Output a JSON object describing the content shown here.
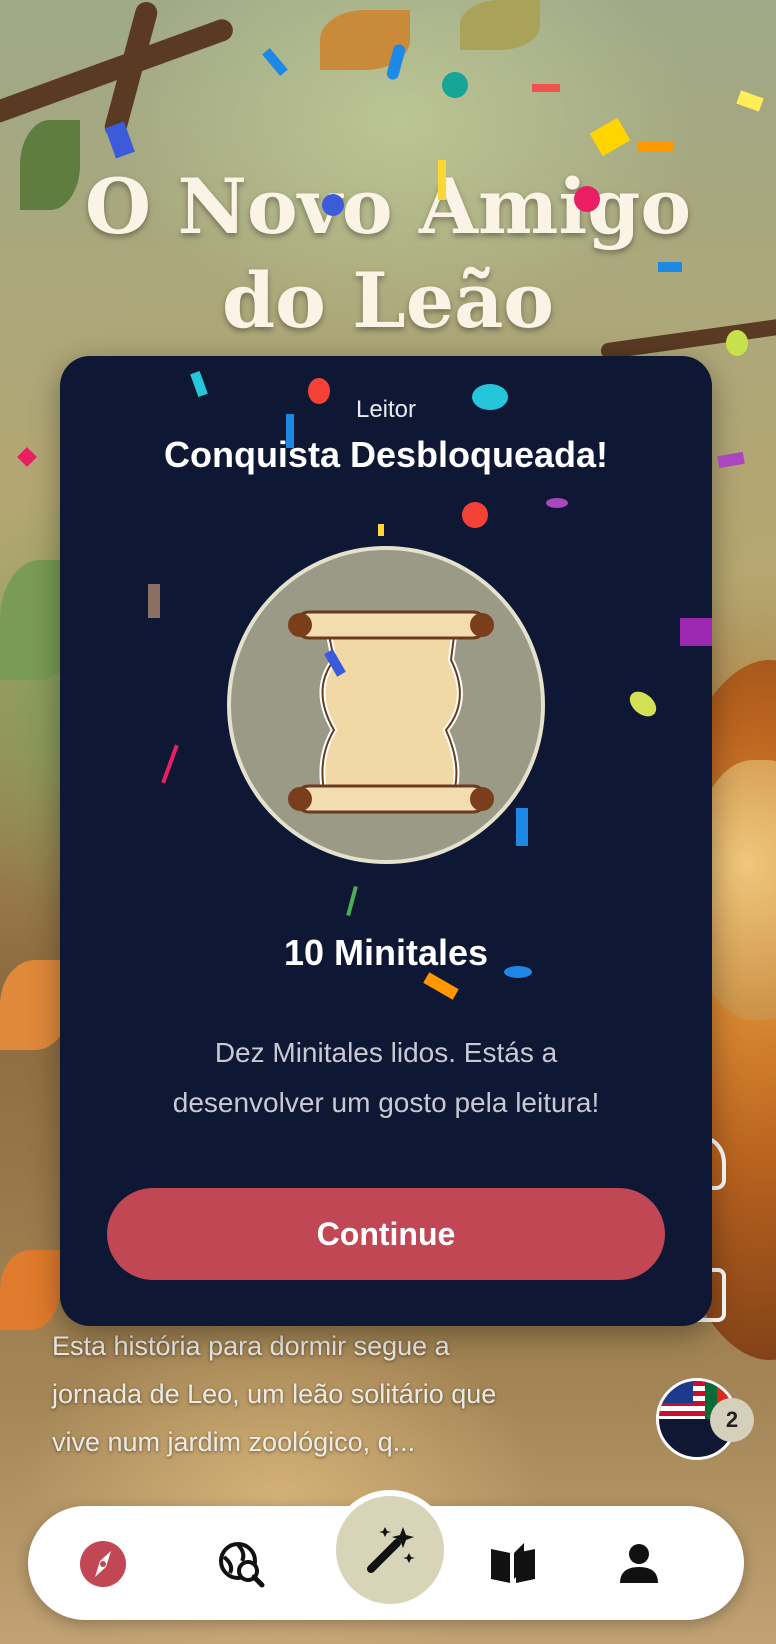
{
  "story": {
    "title_line1": "O Novo Amigo",
    "title_line2": "do Leão",
    "description_line1": "Esta história para dormir segue a",
    "description_line2": "jornada de Leo, um leão solitário que",
    "description_line3": "vive num jardim zoológico, q..."
  },
  "achievement_modal": {
    "eyebrow": "Leitor",
    "title": "Conquista Desbloqueada!",
    "badge_icon": "scroll-icon",
    "name": "10 Minitales",
    "description_line1": "Dez Minitales lidos. Estás a",
    "description_line2": "desenvolver um gosto pela leitura!",
    "continue_label": "Continue"
  },
  "language": {
    "flags": [
      "us-flag-icon",
      "portugal-flag-icon"
    ],
    "count": "2"
  },
  "bottom_nav": {
    "items": [
      {
        "icon": "compass-icon",
        "active": true
      },
      {
        "icon": "globe-search-icon",
        "active": false
      },
      {
        "icon": "magic-wand-icon",
        "active": false
      },
      {
        "icon": "open-book-icon",
        "active": false
      },
      {
        "icon": "profile-icon",
        "active": false
      }
    ]
  },
  "colors": {
    "modal_bg": "#0e1734",
    "accent": "#c04753",
    "badge_bg": "#9a9a86",
    "nav_center_bg": "#d7d4b8"
  }
}
